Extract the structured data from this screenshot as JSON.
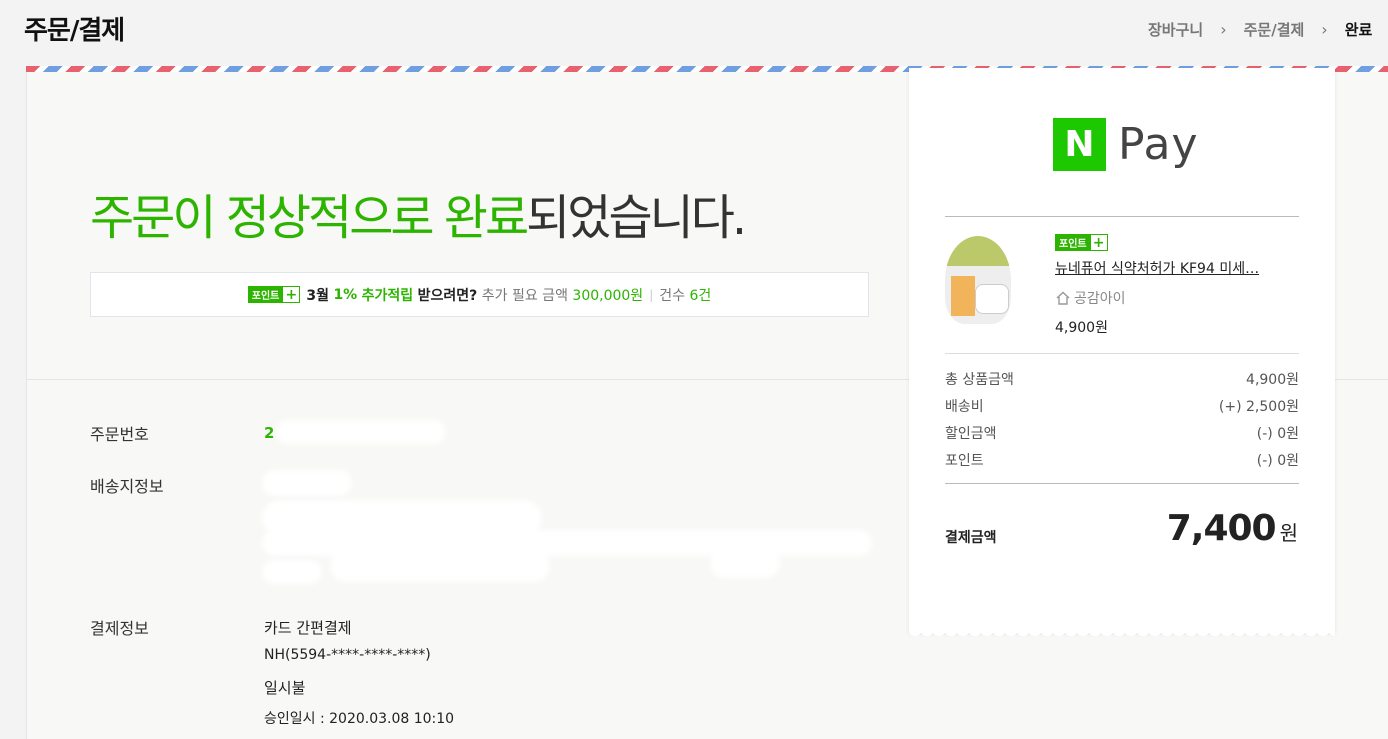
{
  "header": {
    "title": "주문/결제",
    "breadcrumb": [
      "장바구니",
      "주문/결제",
      "완료"
    ]
  },
  "headline": {
    "green_part": "주문이 정상적으로 완료",
    "rest": "되었습니다."
  },
  "point_banner": {
    "badge": "포인트",
    "badge_plus": "+",
    "month": "3월",
    "rate": "1%",
    "accrual": "추가적립",
    "question": "받으려면?",
    "need_label": "추가 필요 금액",
    "need_amount": "300,000원",
    "count_label": "건수",
    "count_value": "6건"
  },
  "order_info": {
    "order_no_label": "주문번호",
    "order_no_value": "2",
    "shipping_label": "배송지정보",
    "payment_label": "결제정보",
    "payment_method": "카드 간편결제",
    "card": "NH(5594-****-****-****)",
    "installment": "일시불",
    "approval": "승인일시 : 2020.03.08 10:10"
  },
  "receipt": {
    "logo_letter": "N",
    "logo_text": "Pay",
    "product": {
      "badge": "포인트",
      "badge_plus": "+",
      "name": "뉴네퓨어 식약처허가 KF94 미세…",
      "seller": "공감아이",
      "price": "4,900원"
    },
    "summary": [
      {
        "label": "총 상품금액",
        "value": "4,900원"
      },
      {
        "label": "배송비",
        "value": "(+) 2,500원"
      },
      {
        "label": "할인금액",
        "value": "(-) 0원"
      },
      {
        "label": "포인트",
        "value": "(-) 0원"
      }
    ],
    "total_label": "결제금액",
    "total_amount": "7,400",
    "total_unit": "원"
  },
  "colors": {
    "naver_green": "#2db400",
    "npay_green": "#1ec800"
  }
}
